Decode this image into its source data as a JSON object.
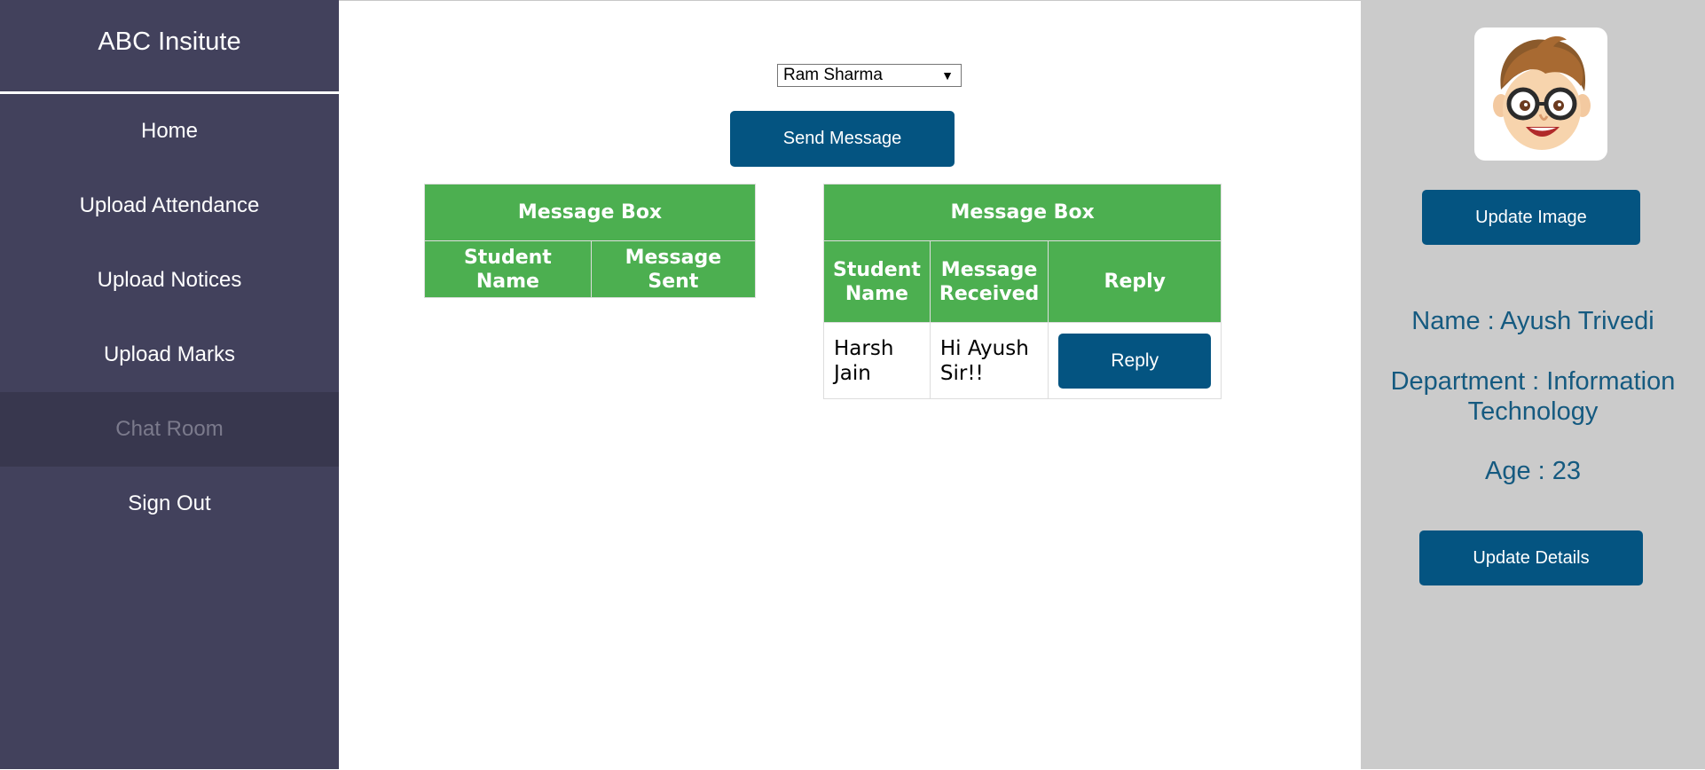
{
  "sidebar": {
    "brand": "ABC Insitute",
    "items": [
      {
        "label": "Home",
        "active": false
      },
      {
        "label": "Upload Attendance",
        "active": false
      },
      {
        "label": "Upload Notices",
        "active": false
      },
      {
        "label": "Upload Marks",
        "active": false
      },
      {
        "label": "Chat Room",
        "active": true
      },
      {
        "label": "Sign Out",
        "active": false
      }
    ]
  },
  "main": {
    "recipient_select": {
      "selected": "Ram Sharma"
    },
    "send_button": "Send Message",
    "sent_table": {
      "title": "Message Box",
      "columns": [
        "Student Name",
        "Message Sent"
      ],
      "rows": []
    },
    "received_table": {
      "title": "Message Box",
      "columns": [
        "Student Name",
        "Message Received",
        "Reply"
      ],
      "rows": [
        {
          "student": "Harsh Jain",
          "message": "Hi Ayush Sir!!",
          "reply_label": "Reply"
        }
      ]
    }
  },
  "profile": {
    "avatar_icon": "cartoon-boy-with-glasses-avatar",
    "update_image_button": "Update Image",
    "name": "Name : Ayush Trivedi",
    "department": "Department : Information Technology",
    "age": "Age : 23",
    "update_details_button": "Update Details"
  },
  "colors": {
    "sidebar_bg": "#42415c",
    "button_blue": "#045481",
    "table_header_green": "#4caf50",
    "profile_bg": "#cbcbcb",
    "profile_text": "#155a80"
  }
}
